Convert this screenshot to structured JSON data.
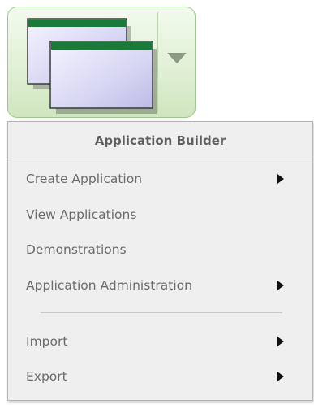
{
  "app_button": {
    "icon": "application-windows-icon",
    "dropdown_icon": "chevron-down-icon",
    "accent_green": "#1a7a3a",
    "background": "#e1f0d6"
  },
  "menu": {
    "header": "Application Builder",
    "items": [
      {
        "label": "Create Application",
        "submenu": true,
        "icon": "submenu-arrow-icon"
      },
      {
        "label": "View Applications",
        "submenu": false
      },
      {
        "label": "Demonstrations",
        "submenu": false
      },
      {
        "label": "Application Administration",
        "submenu": true,
        "icon": "submenu-arrow-icon"
      },
      {
        "label": "Import",
        "submenu": true,
        "icon": "submenu-arrow-icon"
      },
      {
        "label": "Export",
        "submenu": true,
        "icon": "submenu-arrow-icon"
      }
    ],
    "text_color": "#6b6b6b",
    "background": "#efefef"
  }
}
